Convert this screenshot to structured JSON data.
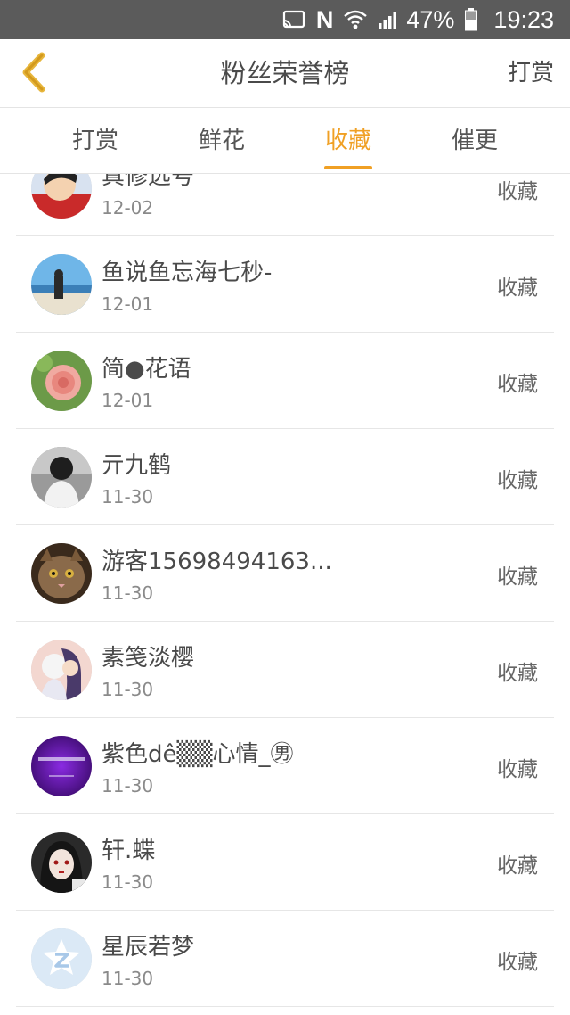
{
  "status_bar": {
    "battery": "47%",
    "time": "19:23",
    "icons": [
      "cast-icon",
      "n-icon",
      "wifi-icon",
      "signal-icon",
      "battery-icon"
    ]
  },
  "header": {
    "title": "粉丝荣誉榜",
    "back_icon": "back-chevron-icon",
    "action_label": "打赏"
  },
  "tabs": [
    {
      "label": "打赏",
      "active": false
    },
    {
      "label": "鲜花",
      "active": false
    },
    {
      "label": "收藏",
      "active": true
    },
    {
      "label": "催更",
      "active": false
    }
  ],
  "accent_color": "#f0a024",
  "rows": [
    {
      "name": "真修远号",
      "date": "12-02",
      "action": "收藏",
      "avatar": "cartoon-avatar"
    },
    {
      "name": "鱼说鱼忘海七秒-",
      "date": "12-01",
      "action": "收藏",
      "avatar": "beach-avatar"
    },
    {
      "name": "简●花语",
      "date": "12-01",
      "action": "收藏",
      "avatar": "flower-avatar"
    },
    {
      "name": "亓九鹤",
      "date": "11-30",
      "action": "收藏",
      "avatar": "person-avatar"
    },
    {
      "name": "游客15698494163...",
      "date": "11-30",
      "action": "收藏",
      "avatar": "cat-avatar"
    },
    {
      "name": "素笺淡樱",
      "date": "11-30",
      "action": "收藏",
      "avatar": "anime-couple-avatar"
    },
    {
      "name": "紫色dê▒▒心情_㊚",
      "date": "11-30",
      "action": "收藏",
      "avatar": "purple-avatar"
    },
    {
      "name": "轩.蝶",
      "date": "11-30",
      "action": "收藏",
      "avatar": "anime-girl-avatar"
    },
    {
      "name": "星辰若梦",
      "date": "11-30",
      "action": "收藏",
      "avatar": "default-avatar"
    }
  ]
}
